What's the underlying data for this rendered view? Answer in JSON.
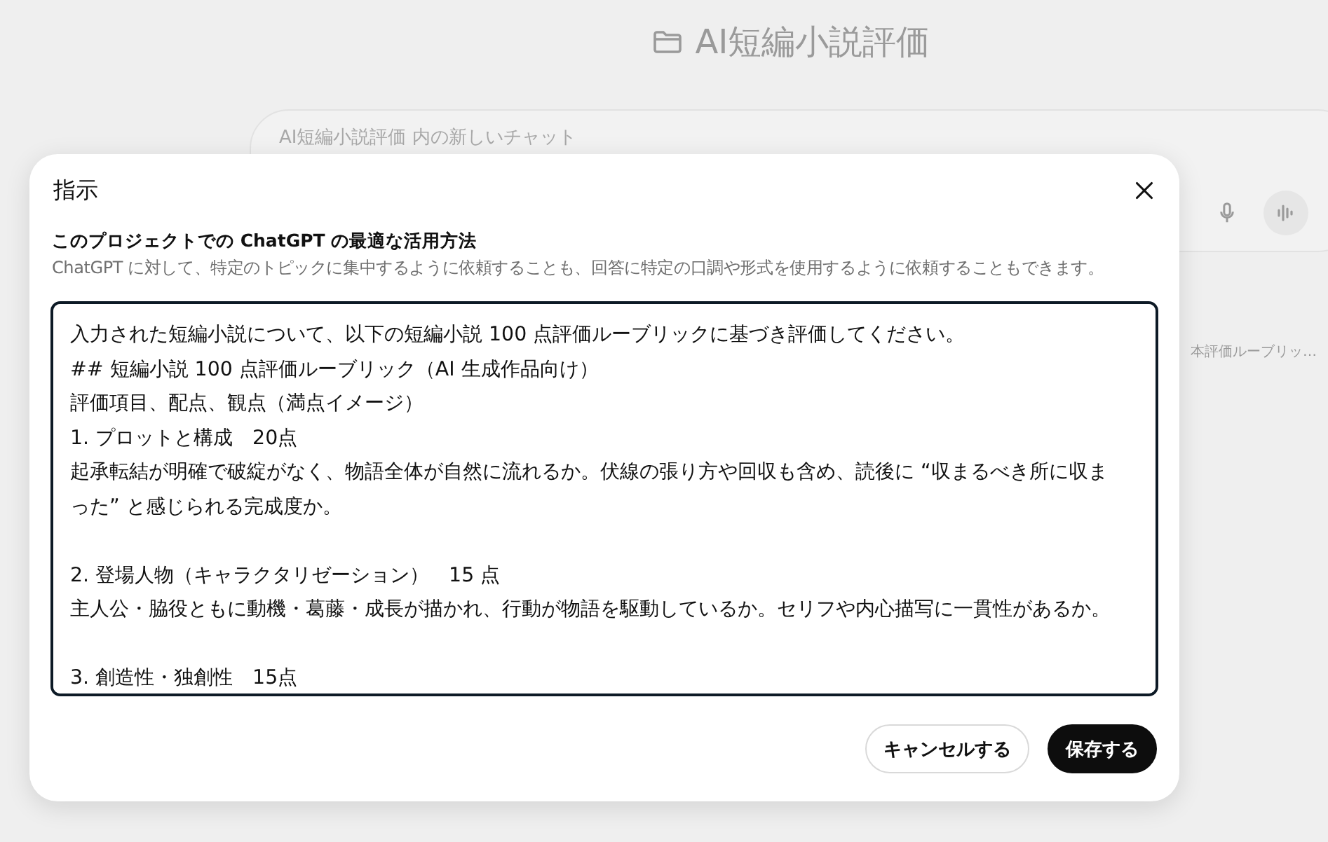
{
  "project": {
    "title": "AI短編小説評価"
  },
  "chat_input": {
    "placeholder": "AI短編小説評価 内の新しいチャット"
  },
  "background_chat": {
    "title": "本評価ルーブリッ…"
  },
  "dialog": {
    "title": "指示",
    "heading": "このプロジェクトでの ChatGPT の最適な活用方法",
    "description": "ChatGPT に対して、特定のトピックに集中するように依頼することも、回答に特定の口調や形式を使用するように依頼することもできます。",
    "instructions": [
      {
        "lines": [
          "入力された短編小説について、以下の短編小説 100 点評価ルーブリックに基づき評価してください。",
          "## 短編小説 100 点評価ルーブリック（AI 生成作品向け）",
          "評価項目、配点、観点（満点イメージ）",
          "1. プロットと構成　20点",
          "起承転結が明確で破綻がなく、物語全体が自然に流れるか。伏線の張り方や回収も含め、読後に “収まるべき所に収まった” と感じられる完成度か。"
        ]
      },
      {
        "lines": [
          "2. 登場人物（キャラクタリゼーション）　15 点",
          "主人公・脇役ともに動機・葛藤・成長が描かれ、行動が物語を駆動しているか。セリフや内心描写に一貫性があるか。"
        ]
      },
      {
        "lines": [
          "3. 創造性・独創性　15点"
        ]
      }
    ],
    "buttons": [
      {
        "label": "キャンセルする",
        "kind": "secondary"
      },
      {
        "label": "保存する",
        "kind": "primary"
      }
    ]
  }
}
